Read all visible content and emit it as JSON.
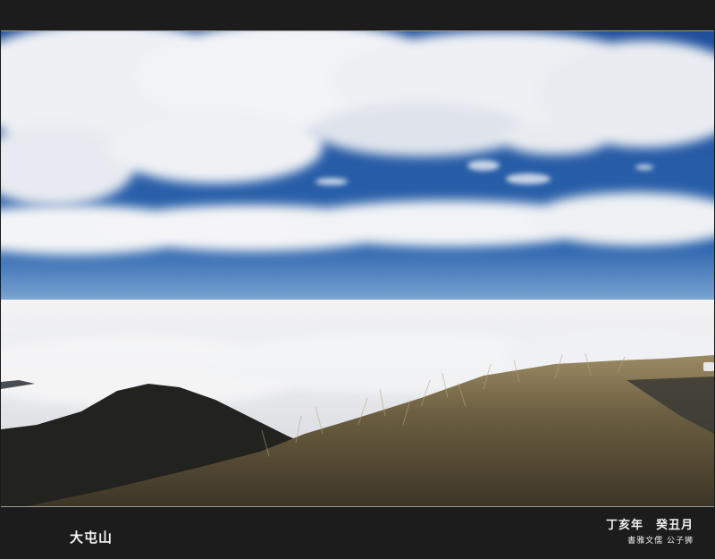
{
  "photo": {
    "scene": "mountain-ridge-above-sea-of-clouds"
  },
  "caption": {
    "location": "大屯山",
    "date_line": "丁亥年　癸丑月",
    "credit_line": "書雅文儒 公子狮"
  },
  "colors": {
    "frame": "#1c1c1c",
    "sky_blue": "#2a5fa8",
    "cloud_white": "#f2f3f5",
    "grass": "#6e6245",
    "hill": "#232320"
  }
}
